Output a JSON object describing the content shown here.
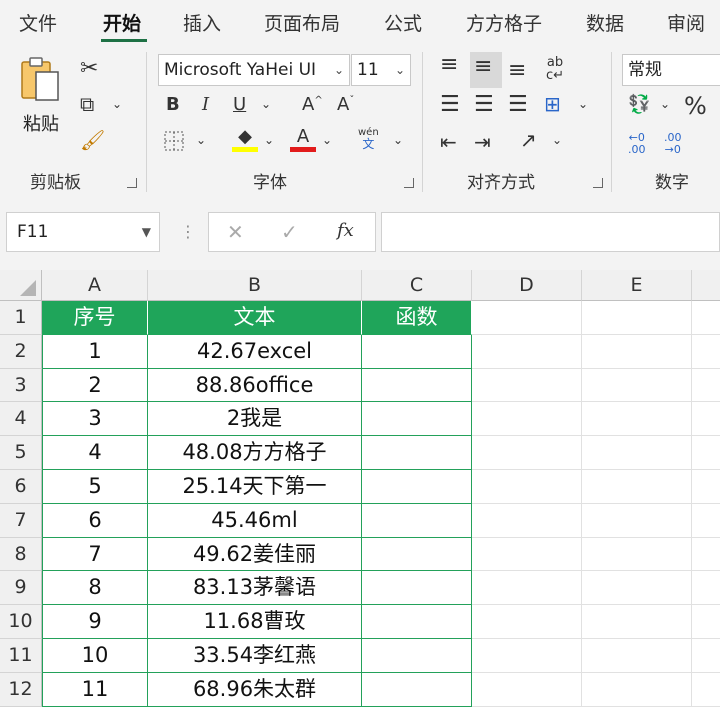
{
  "menu": {
    "items": [
      "文件",
      "开始",
      "插入",
      "页面布局",
      "公式",
      "方方格子",
      "数据",
      "审阅"
    ],
    "active_index": 1
  },
  "ribbon": {
    "clipboard": {
      "paste_label": "粘贴",
      "group_label": "剪贴板"
    },
    "font": {
      "font_name": "Microsoft YaHei UI",
      "font_size": "11",
      "bold": "B",
      "italic": "I",
      "underline": "U",
      "grow": "A",
      "shrink": "A",
      "font_color_glyph": "A",
      "phonetic_top": "wén",
      "phonetic_bottom": "文",
      "group_label": "字体"
    },
    "alignment": {
      "group_label": "对齐方式"
    },
    "number": {
      "format": "常规",
      "percent": "%",
      "group_label": "数字"
    }
  },
  "formula_bar": {
    "name_box": "F11",
    "fx": "fx",
    "formula": ""
  },
  "sheet": {
    "columns": [
      "A",
      "B",
      "C",
      "D",
      "E"
    ],
    "rows": [
      "1",
      "2",
      "3",
      "4",
      "5",
      "6",
      "7",
      "8",
      "9",
      "10",
      "11",
      "12"
    ],
    "header": [
      "序号",
      "文本",
      "函数"
    ],
    "data": [
      [
        "1",
        "42.67excel",
        ""
      ],
      [
        "2",
        "88.86office",
        ""
      ],
      [
        "3",
        "2我是",
        ""
      ],
      [
        "4",
        "48.08方方格子",
        ""
      ],
      [
        "5",
        "25.14天下第一",
        ""
      ],
      [
        "6",
        "45.46ml",
        ""
      ],
      [
        "7",
        "49.62姜佳丽",
        ""
      ],
      [
        "8",
        "83.13茅馨语",
        ""
      ],
      [
        "9",
        "11.68曹玫",
        ""
      ],
      [
        "10",
        "33.54李红燕",
        ""
      ],
      [
        "11",
        "68.96朱太群",
        ""
      ]
    ]
  },
  "colors": {
    "accent": "#1e7145",
    "table_header": "#1fa55a",
    "table_border": "#23a15a"
  }
}
